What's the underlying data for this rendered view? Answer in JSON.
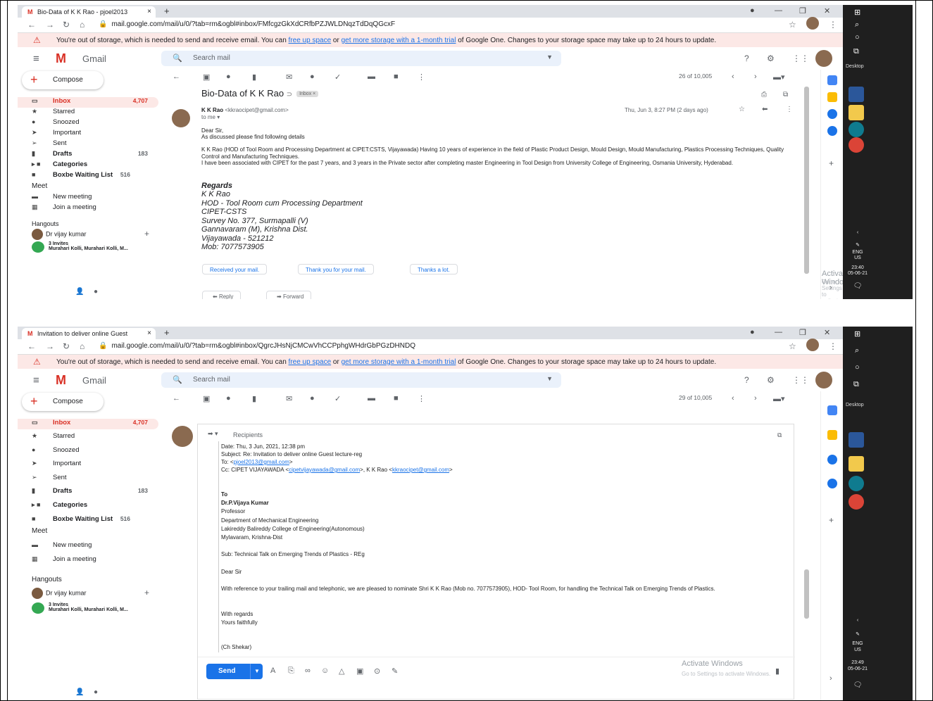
{
  "shot1": {
    "tab_title": "Bio-Data of K K Rao - pjoel2013",
    "url": "mail.google.com/mail/u/0/?tab=rm&ogbl#inbox/FMfcgzGkXdCRfbPZJWLDNqzTdDqQGcxF",
    "count": "26 of 10,005",
    "subject": "Bio-Data of K K Rao",
    "label": "Inbox ×",
    "sender_name": "K K Rao",
    "sender_email": "<kkraocipet@gmail.com>",
    "to_me": "to me ▾",
    "date": "Thu, Jun 3, 8:27 PM (2 days ago)",
    "greeting": "Dear Sir,",
    "line1": "As discussed please find following details",
    "para1": "K K Rao (HOD of Tool Room and Processing Department at CIPET:CSTS, Vijayawada) Having 10 years of experience in the field of Plastic Product Design, Mould Design, Mould Manufacturing, Plastics Processing Techniques, Quality Control and Manufacturing Techniques.",
    "para2": "I have been associated with CIPET for the past 7 years, and 3 years in the Private sector after completing master Engineering in Tool Design from University College of Engineering, Osmania University, Hyderabad.",
    "sig_regards": "Regards",
    "sig_lines": [
      "K K Rao",
      "HOD - Tool Room cum Processing Department",
      "CIPET-CSTS",
      "Survey No. 377, Surmapalli (V)",
      "Gannavaram (M), Krishna Dist.",
      "Vijayawada - 521212",
      "Mob: 7077573905"
    ],
    "chips": [
      "Received your mail.",
      "Thank you for your mail.",
      "Thanks a lot."
    ],
    "reply": "Reply",
    "forward": "Forward",
    "clock": "23:40",
    "clock_date": "05-06-21"
  },
  "shot2": {
    "tab_title": "Invitation to deliver online Guest",
    "url": "mail.google.com/mail/u/0/?tab=rm&ogbl#inbox/QgrcJHsNjCMCwVhCCPphgWHdrGbPGzDHNDQ",
    "count": "29 of 10,005",
    "recipients": "Recipients",
    "hdr_date": "Date: Thu, 3 Jun, 2021, 12:38 pm",
    "hdr_subject": "Subject: Re: Invitation to deliver online Guest lecture-reg",
    "hdr_to_prefix": "To: <",
    "hdr_to_email": "pjoel2013@gmail.com",
    "hdr_to_suffix": ">",
    "hdr_cc_prefix": "Cc: CIPET VIJAYAWADA <",
    "hdr_cc_email1": "cipetvijayawada@gmail.com",
    "hdr_cc_mid": ">, K K Rao <",
    "hdr_cc_email2": "kkraocipet@gmail.com",
    "hdr_cc_suffix": ">",
    "to": "To",
    "addr": [
      "Dr.P.Vijaya Kumar",
      "Professor",
      "Department of Mechanical Engineering",
      "Lakireddy Balireddy College of Engineering(Autonomous)",
      "Mylavaram, Krishna-Dist"
    ],
    "sub": "Sub: Technical Talk on Emerging Trends of Plastics - REg",
    "dear": "Dear Sir",
    "body": "With reference to your trailing mail and telephonic, we are pleased to nominate Shri K K Rao (Mob no. 7077573905), HOD- Tool Room, for handling the Technical Talk on Emerging Trends of Plastics.",
    "with_regards": "With regards",
    "yours": "Yours faithfully",
    "signed": "(Ch Shekar)",
    "send": "Send",
    "clock": "23:49",
    "clock_date": "05-06-21"
  },
  "common": {
    "banner_pre": "You're out of storage, which is needed to send and receive email. You can ",
    "banner_link1": "free up space",
    "banner_mid": " or ",
    "banner_link2": "get more storage with a 1-month trial",
    "banner_post": " of Google One. Changes to your storage space may take up to 24 hours to update.",
    "gmail": "Gmail",
    "search_placeholder": "Search mail",
    "compose": "Compose",
    "nav": [
      {
        "label": "Inbox",
        "count": "4,707"
      },
      {
        "label": "Starred",
        "count": ""
      },
      {
        "label": "Snoozed",
        "count": ""
      },
      {
        "label": "Important",
        "count": ""
      },
      {
        "label": "Sent",
        "count": ""
      },
      {
        "label": "Drafts",
        "count": "183"
      },
      {
        "label": "Categories",
        "count": ""
      },
      {
        "label": "Boxbe Waiting List",
        "count": "516"
      }
    ],
    "meet": "Meet",
    "new_meeting": "New meeting",
    "join_meeting": "Join a meeting",
    "hangouts": "Hangouts",
    "hangout_user": "Dr vijay kumar",
    "invites_title": "3 Invites",
    "invites_names": "Murahari Kolli, Murahari Kolli, M...",
    "activate_title": "Activate Windows",
    "activate_sub": "Go to Settings to activate Windows.",
    "desktop": "Desktop",
    "lang1": "ENG",
    "lang2": "US"
  }
}
